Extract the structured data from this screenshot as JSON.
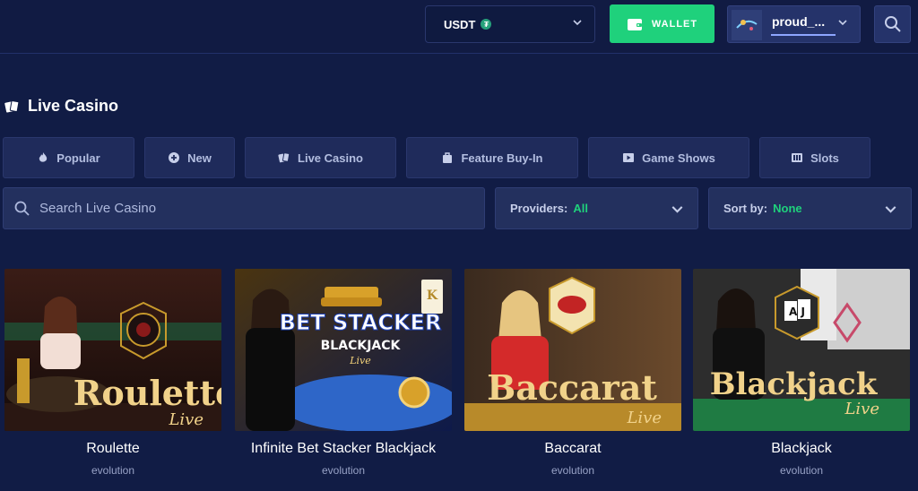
{
  "header": {
    "currency": "USDT",
    "currency_coin": "₮",
    "wallet_label": "WALLET",
    "username": "proud_..."
  },
  "section": {
    "title": "Live Casino"
  },
  "tabs": [
    {
      "label": "Popular",
      "icon": "fire-icon"
    },
    {
      "label": "New",
      "icon": "plus-circle-icon"
    },
    {
      "label": "Live Casino",
      "icon": "cards-icon"
    },
    {
      "label": "Feature Buy-In",
      "icon": "bag-icon"
    },
    {
      "label": "Game Shows",
      "icon": "play-icon"
    },
    {
      "label": "Slots",
      "icon": "slots-icon"
    }
  ],
  "search": {
    "placeholder": "Search Live Casino"
  },
  "filters": {
    "providers_label": "Providers:",
    "providers_value": "All",
    "sort_label": "Sort by:",
    "sort_value": "None"
  },
  "games": [
    {
      "title": "Roulette",
      "provider": "evolution",
      "art_title": "Roulette",
      "art_sub": "Live"
    },
    {
      "title": "Infinite Bet Stacker Blackjack",
      "provider": "evolution",
      "art_title": "BET STACKER",
      "art_line2": "BLACKJACK",
      "art_sub": "Live",
      "art_card": "K"
    },
    {
      "title": "Baccarat",
      "provider": "evolution",
      "art_title": "Baccarat",
      "art_sub": "Live"
    },
    {
      "title": "Blackjack",
      "provider": "evolution",
      "art_title": "Blackjack",
      "art_sub": "Live",
      "art_cards": "A J"
    }
  ],
  "colors": {
    "background": "#111c45",
    "accent_green": "#1fd17c",
    "tab_bg": "#1f2b5b"
  }
}
